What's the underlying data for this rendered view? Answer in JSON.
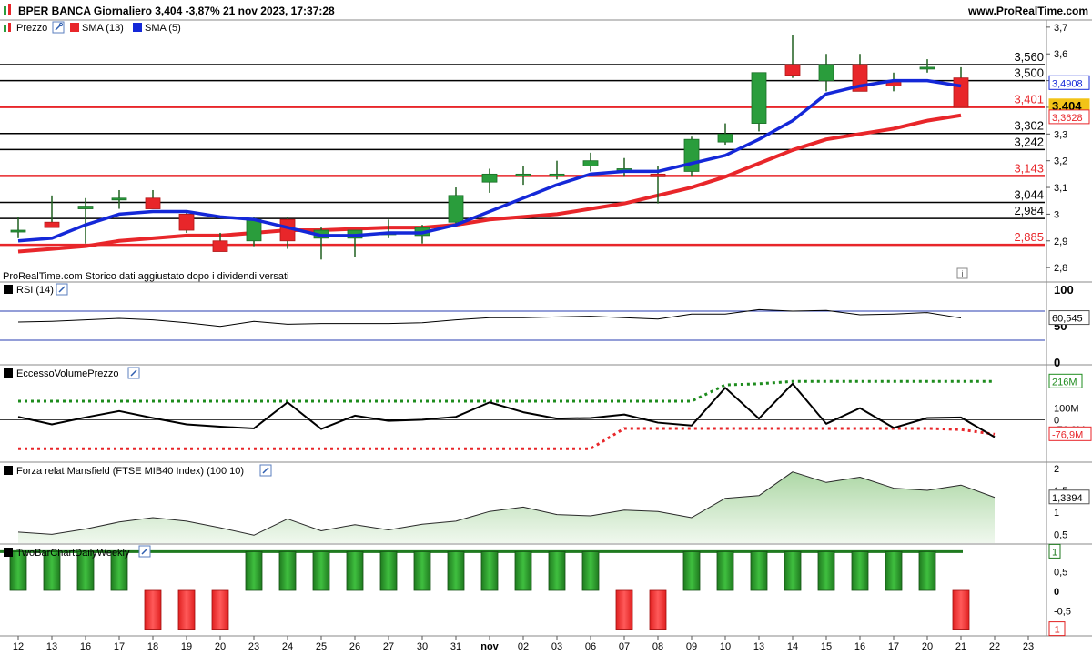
{
  "header": {
    "title": "BPER BANCA Giornaliero 3,404 -3,87% 21 nov 2023, 17:37:28",
    "site": "www.ProRealTime.com"
  },
  "colors": {
    "up": "#2a9d3c",
    "down": "#e8262a",
    "sma13": "#e8262a",
    "sma5": "#1428d8",
    "grid_line": "#000000",
    "red_level": "#e8262a",
    "current_price_bg": "#f2c318",
    "green_dots": "#1e8c1e",
    "red_dots": "#e8262a",
    "area_fill": "#a8d5a0"
  },
  "price_panel": {
    "legend": [
      {
        "icon": "candlestick-icon",
        "label": "Prezzo"
      },
      {
        "icon": "red-square-icon",
        "label": "SMA (13)"
      },
      {
        "icon": "blue-square-icon",
        "label": "SMA (5)"
      }
    ],
    "footer_note": "ProRealTime.com  Storico dati aggiustato dopo i dividendi versati",
    "info_icon": "info-icon",
    "y_ticks": [
      "3,7",
      "3,6",
      "3,5",
      "3,4",
      "3,3",
      "3,2",
      "3,1",
      "3",
      "2,9",
      "2,8"
    ],
    "levels": [
      {
        "value": 3.56,
        "label": "3,560",
        "color": "black"
      },
      {
        "value": 3.5,
        "label": "3,500",
        "color": "black"
      },
      {
        "value": 3.401,
        "label": "3,401",
        "color": "red"
      },
      {
        "value": 3.302,
        "label": "3,302",
        "color": "black"
      },
      {
        "value": 3.242,
        "label": "3,242",
        "color": "black"
      },
      {
        "value": 3.143,
        "label": "3,143",
        "color": "red"
      },
      {
        "value": 3.044,
        "label": "3,044",
        "color": "black"
      },
      {
        "value": 2.984,
        "label": "2,984",
        "color": "black"
      },
      {
        "value": 2.885,
        "label": "2,885",
        "color": "red"
      }
    ],
    "right_badges": [
      {
        "value": 3.4908,
        "label": "3,4908",
        "style": "blue"
      },
      {
        "value": 3.404,
        "label": "3,404",
        "style": "current"
      },
      {
        "value": 3.3628,
        "label": "3,3628",
        "style": "red"
      }
    ]
  },
  "chart_data": [
    {
      "type": "candlestick",
      "title": "BPER BANCA Giornaliero",
      "x": [
        "12",
        "13",
        "16",
        "17",
        "18",
        "19",
        "20",
        "23",
        "24",
        "25",
        "26",
        "27",
        "30",
        "31",
        "nov",
        "02",
        "03",
        "06",
        "07",
        "08",
        "09",
        "10",
        "13",
        "14",
        "15",
        "16",
        "17",
        "20",
        "21"
      ],
      "ohlc": [
        [
          2.94,
          2.99,
          2.91,
          2.94
        ],
        [
          2.97,
          3.07,
          2.96,
          2.95
        ],
        [
          3.02,
          3.06,
          2.89,
          3.03
        ],
        [
          3.06,
          3.09,
          3.02,
          3.06
        ],
        [
          3.06,
          3.09,
          3.02,
          3.02
        ],
        [
          3.0,
          3.01,
          2.93,
          2.94
        ],
        [
          2.9,
          2.93,
          2.86,
          2.86
        ],
        [
          2.9,
          2.99,
          2.88,
          2.98
        ],
        [
          2.98,
          2.99,
          2.87,
          2.9
        ],
        [
          2.91,
          2.95,
          2.83,
          2.94
        ],
        [
          2.91,
          2.93,
          2.84,
          2.94
        ],
        [
          2.93,
          2.98,
          2.91,
          2.93
        ],
        [
          2.92,
          2.96,
          2.89,
          2.95
        ],
        [
          2.97,
          3.1,
          2.96,
          3.07
        ],
        [
          3.12,
          3.17,
          3.08,
          3.15
        ],
        [
          3.15,
          3.18,
          3.11,
          3.15
        ],
        [
          3.15,
          3.2,
          3.13,
          3.15
        ],
        [
          3.18,
          3.23,
          3.16,
          3.2
        ],
        [
          3.17,
          3.21,
          3.14,
          3.17
        ],
        [
          3.15,
          3.18,
          3.04,
          3.14
        ],
        [
          3.16,
          3.29,
          3.14,
          3.28
        ],
        [
          3.27,
          3.34,
          3.26,
          3.3
        ],
        [
          3.34,
          3.53,
          3.31,
          3.53
        ],
        [
          3.56,
          3.67,
          3.51,
          3.52
        ],
        [
          3.5,
          3.6,
          3.46,
          3.56
        ],
        [
          3.56,
          3.6,
          3.46,
          3.46
        ],
        [
          3.5,
          3.53,
          3.46,
          3.48
        ],
        [
          3.55,
          3.58,
          3.53,
          3.55
        ],
        [
          3.51,
          3.55,
          3.4,
          3.4
        ]
      ],
      "series": [
        {
          "name": "SMA (13)",
          "values": [
            2.86,
            2.87,
            2.88,
            2.9,
            2.91,
            2.92,
            2.92,
            2.93,
            2.94,
            2.94,
            2.945,
            2.95,
            2.95,
            2.96,
            2.98,
            2.99,
            3.0,
            3.02,
            3.04,
            3.07,
            3.1,
            3.14,
            3.19,
            3.24,
            3.28,
            3.3,
            3.32,
            3.35,
            3.37
          ]
        },
        {
          "name": "SMA (5)",
          "values": [
            2.9,
            2.91,
            2.96,
            3.0,
            3.01,
            3.01,
            2.99,
            2.98,
            2.95,
            2.92,
            2.92,
            2.93,
            2.93,
            2.96,
            3.01,
            3.06,
            3.11,
            3.15,
            3.16,
            3.16,
            3.19,
            3.22,
            3.28,
            3.35,
            3.45,
            3.48,
            3.5,
            3.5,
            3.48
          ]
        }
      ],
      "ylim": [
        2.78,
        3.72
      ],
      "xlabel": "",
      "ylabel": ""
    },
    {
      "type": "line",
      "title": "RSI (14)",
      "series": [
        {
          "name": "RSI (14)",
          "values": [
            55,
            56,
            58,
            60,
            58,
            54,
            49,
            56,
            52,
            53,
            53,
            53,
            54,
            58,
            61,
            61,
            62,
            63,
            61,
            59,
            66,
            66,
            72,
            70,
            71,
            65,
            66,
            68,
            60.545
          ]
        }
      ],
      "ylim": [
        0,
        100
      ],
      "reference_lines": [
        70,
        30
      ],
      "y_ticks": [
        "100",
        "50",
        "0"
      ],
      "last_label": "60,545"
    },
    {
      "type": "line",
      "title": "EccessoVolumePrezzo",
      "series": [
        {
          "name": "EccessoVolumePrezzo",
          "values": [
            5,
            -8,
            4,
            15,
            3,
            -8,
            -12,
            -15,
            30,
            -16,
            7,
            -2,
            0,
            5,
            30,
            13,
            2,
            3,
            9,
            -5,
            -10,
            55,
            2,
            62,
            -7,
            20,
            -14,
            3,
            4,
            -30
          ]
        },
        {
          "name": "upper band",
          "values": [
            32,
            32,
            32,
            32,
            32,
            32,
            32,
            32,
            32,
            32,
            32,
            32,
            32,
            32,
            32,
            32,
            32,
            32,
            32,
            32,
            32,
            60,
            62,
            66,
            66,
            66,
            66,
            66,
            66,
            66
          ]
        },
        {
          "name": "lower band",
          "values": [
            -50,
            -50,
            -50,
            -50,
            -50,
            -50,
            -50,
            -50,
            -50,
            -50,
            -50,
            -50,
            -50,
            -50,
            -50,
            -50,
            -50,
            -50,
            -15,
            -15,
            -15,
            -15,
            -15,
            -15,
            -15,
            -15,
            -15,
            -15,
            -17,
            -25
          ]
        }
      ],
      "ylim": [
        -70,
        90
      ],
      "y_ticks": [
        "216M",
        "100M",
        "0",
        "-76,9M"
      ],
      "badges": [
        "216M",
        "-76,9M"
      ]
    },
    {
      "type": "area",
      "title": "Forza relat Mansfield (FTSE MIB40 Index) (100 10)",
      "series": [
        {
          "name": "Forza relat Mansfield",
          "values": [
            0.55,
            0.5,
            0.62,
            0.78,
            0.88,
            0.8,
            0.65,
            0.48,
            0.85,
            0.58,
            0.72,
            0.6,
            0.73,
            0.8,
            1.02,
            1.12,
            0.95,
            0.92,
            1.05,
            1.02,
            0.88,
            1.32,
            1.38,
            1.92,
            1.68,
            1.8,
            1.55,
            1.5,
            1.62,
            1.3394
          ]
        }
      ],
      "ylim": [
        0.3,
        2.1
      ],
      "y_ticks": [
        "2",
        "1,5",
        "1",
        "0,5"
      ],
      "last_label": "1,3394"
    },
    {
      "type": "bar",
      "title": "TwoBarChartDailyWeekly",
      "values": [
        1,
        1,
        1,
        1,
        -1,
        -1,
        -1,
        1,
        1,
        1,
        1,
        1,
        1,
        1,
        1,
        1,
        1,
        1,
        -1,
        -1,
        1,
        1,
        1,
        1,
        1,
        1,
        1,
        1,
        -1
      ],
      "ylim": [
        -1.15,
        1.15
      ],
      "y_ticks": [
        "1",
        "0,5",
        "0",
        "-0,5",
        "-1"
      ],
      "badges": [
        "1",
        "-1"
      ]
    }
  ],
  "x_axis": {
    "labels": [
      "12",
      "13",
      "16",
      "17",
      "18",
      "19",
      "20",
      "23",
      "24",
      "25",
      "26",
      "27",
      "30",
      "31",
      "nov",
      "02",
      "03",
      "06",
      "07",
      "08",
      "09",
      "10",
      "13",
      "14",
      "15",
      "16",
      "17",
      "20",
      "21",
      "22",
      "23"
    ],
    "bold_index": 14
  }
}
